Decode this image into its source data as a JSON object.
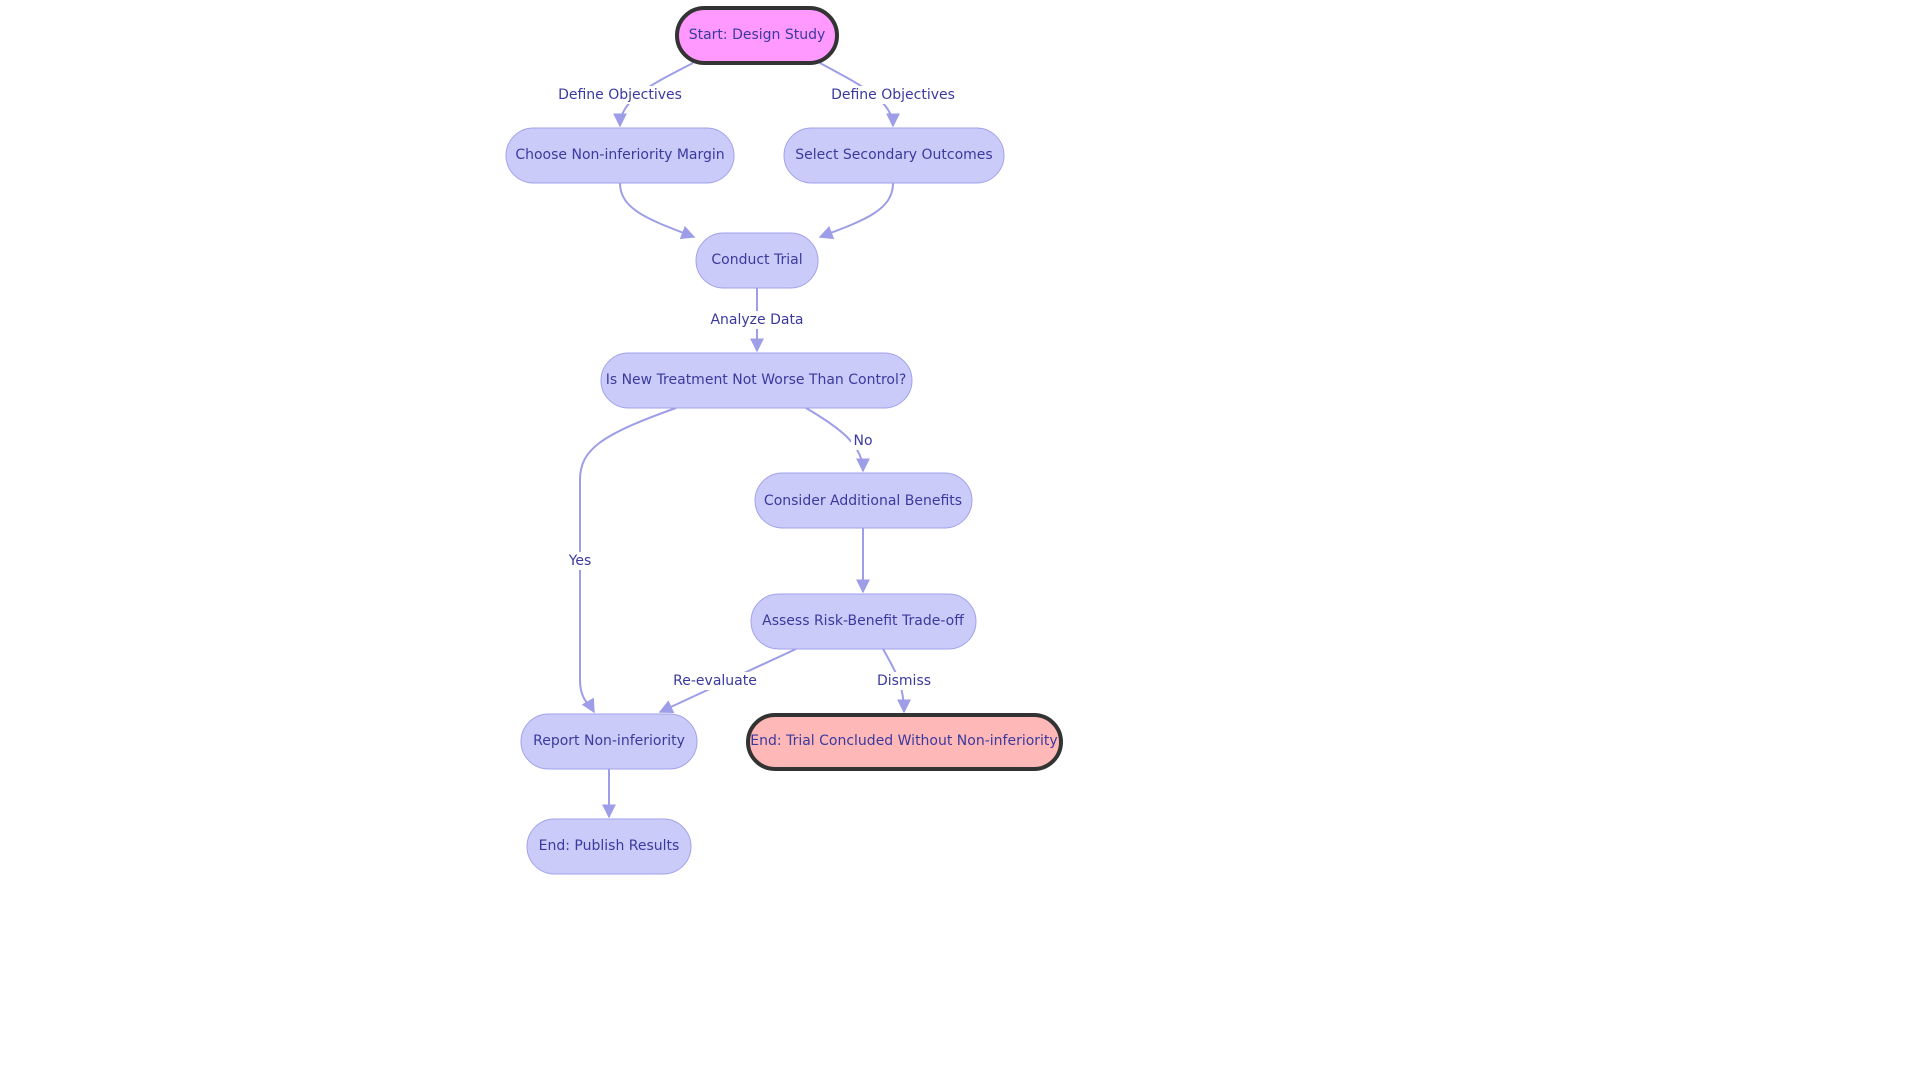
{
  "colors": {
    "node_fill": "#cbcbfa",
    "node_stroke": "#a2a2ec",
    "start_fill": "#ff99ff",
    "end_fail_fill": "#ffb8b8",
    "terminal_stroke": "#333333",
    "text": "#3a3a9e",
    "edge": "#9d9de8"
  },
  "nodes": {
    "start": "Start: Design Study",
    "margin": "Choose Non-inferiority Margin",
    "secondary": "Select Secondary Outcomes",
    "trial": "Conduct Trial",
    "decision": "Is New Treatment Not Worse Than Control?",
    "benefits": "Consider Additional Benefits",
    "risk": "Assess Risk-Benefit Trade-off",
    "report": "Report Non-inferiority",
    "end_fail": "End: Trial Concluded Without Non-inferiority",
    "publish": "End: Publish Results"
  },
  "edges": {
    "start_margin": "Define Objectives",
    "start_secondary": "Define Objectives",
    "trial_decision": "Analyze Data",
    "decision_no": "No",
    "decision_yes": "Yes",
    "reevaluate": "Re-evaluate",
    "dismiss": "Dismiss"
  }
}
